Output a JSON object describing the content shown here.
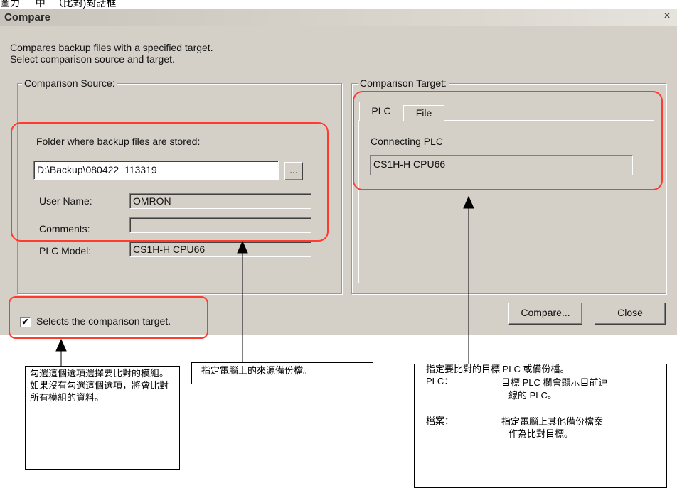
{
  "top_caption": "圖力 　 中 　（比對)對話框",
  "window": {
    "title": "Compare",
    "close_glyph": "×"
  },
  "description": {
    "line1": "Compares backup files with a specified target.",
    "line2": "Select comparison source and target."
  },
  "source": {
    "legend": "Comparison Source:",
    "folder_label": "Folder where backup files are stored:",
    "folder_value": "D:\\Backup\\080422_113319",
    "browse_label": "...",
    "user_name_label": "User Name:",
    "user_name_value": "OMRON",
    "comments_label": "Comments:",
    "comments_value": "",
    "plc_model_label": "PLC Model:",
    "plc_model_value": "CS1H-H CPU66"
  },
  "target": {
    "legend": "Comparison Target:",
    "tabs": [
      "PLC",
      "File"
    ],
    "connecting_label": "Connecting PLC",
    "connecting_value": "CS1H-H CPU66"
  },
  "checkbox": {
    "checked": true,
    "mark": "✔",
    "label": "Selects the comparison target."
  },
  "buttons": {
    "compare": "Compare...",
    "close": "Close"
  },
  "annotations": {
    "left": "勾選這個選項選擇要比對的模組。如果沒有勾選這個選項，將會比對所有模組的資料。",
    "middle": "指定電腦上的來源備份檔。",
    "right_title": "指定要比對的目標 PLC 或備份檔。",
    "right_plc_key": "PLC：",
    "right_plc_line1": "目標 PLC 欄會顯示目前連",
    "right_plc_line2": "線的 PLC。",
    "right_file_key": "檔案：",
    "right_file_line1": "指定電腦上其他備份檔案",
    "right_file_line2": "作為比對目標。"
  },
  "colors": {
    "dialog_bg": "#d4d0c8",
    "highlight": "#ff3b30"
  }
}
